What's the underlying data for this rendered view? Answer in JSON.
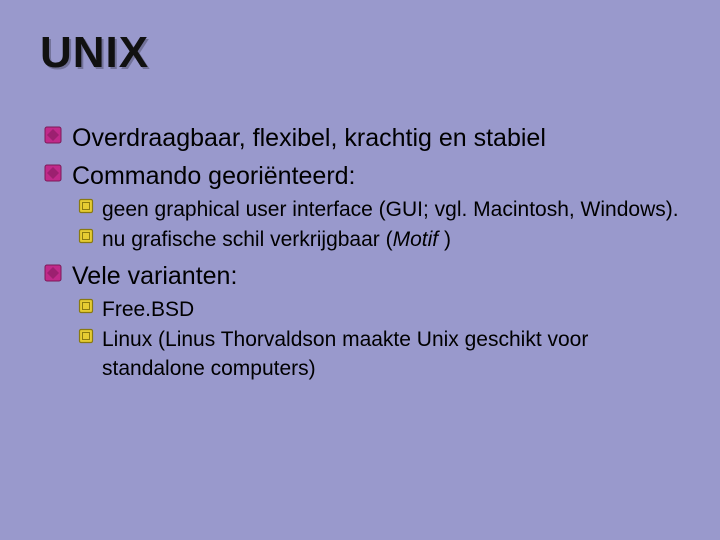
{
  "title": "UNIX",
  "bullets": {
    "b1": "Overdraagbaar, flexibel, krachtig en stabiel",
    "b2": "Commando georiënteerd:",
    "b2_sub1": "geen graphical user interface (GUI; vgl. Macintosh, Windows).",
    "b2_sub2_a": "nu grafische schil verkrijgbaar (",
    "b2_sub2_i": "Motif",
    "b2_sub2_b": ")",
    "b3": "Vele varianten:",
    "b3_sub1": "Free.BSD",
    "b3_sub2": "Linux (Linus Thorvaldson maakte Unix geschikt voor standalone computers)"
  }
}
